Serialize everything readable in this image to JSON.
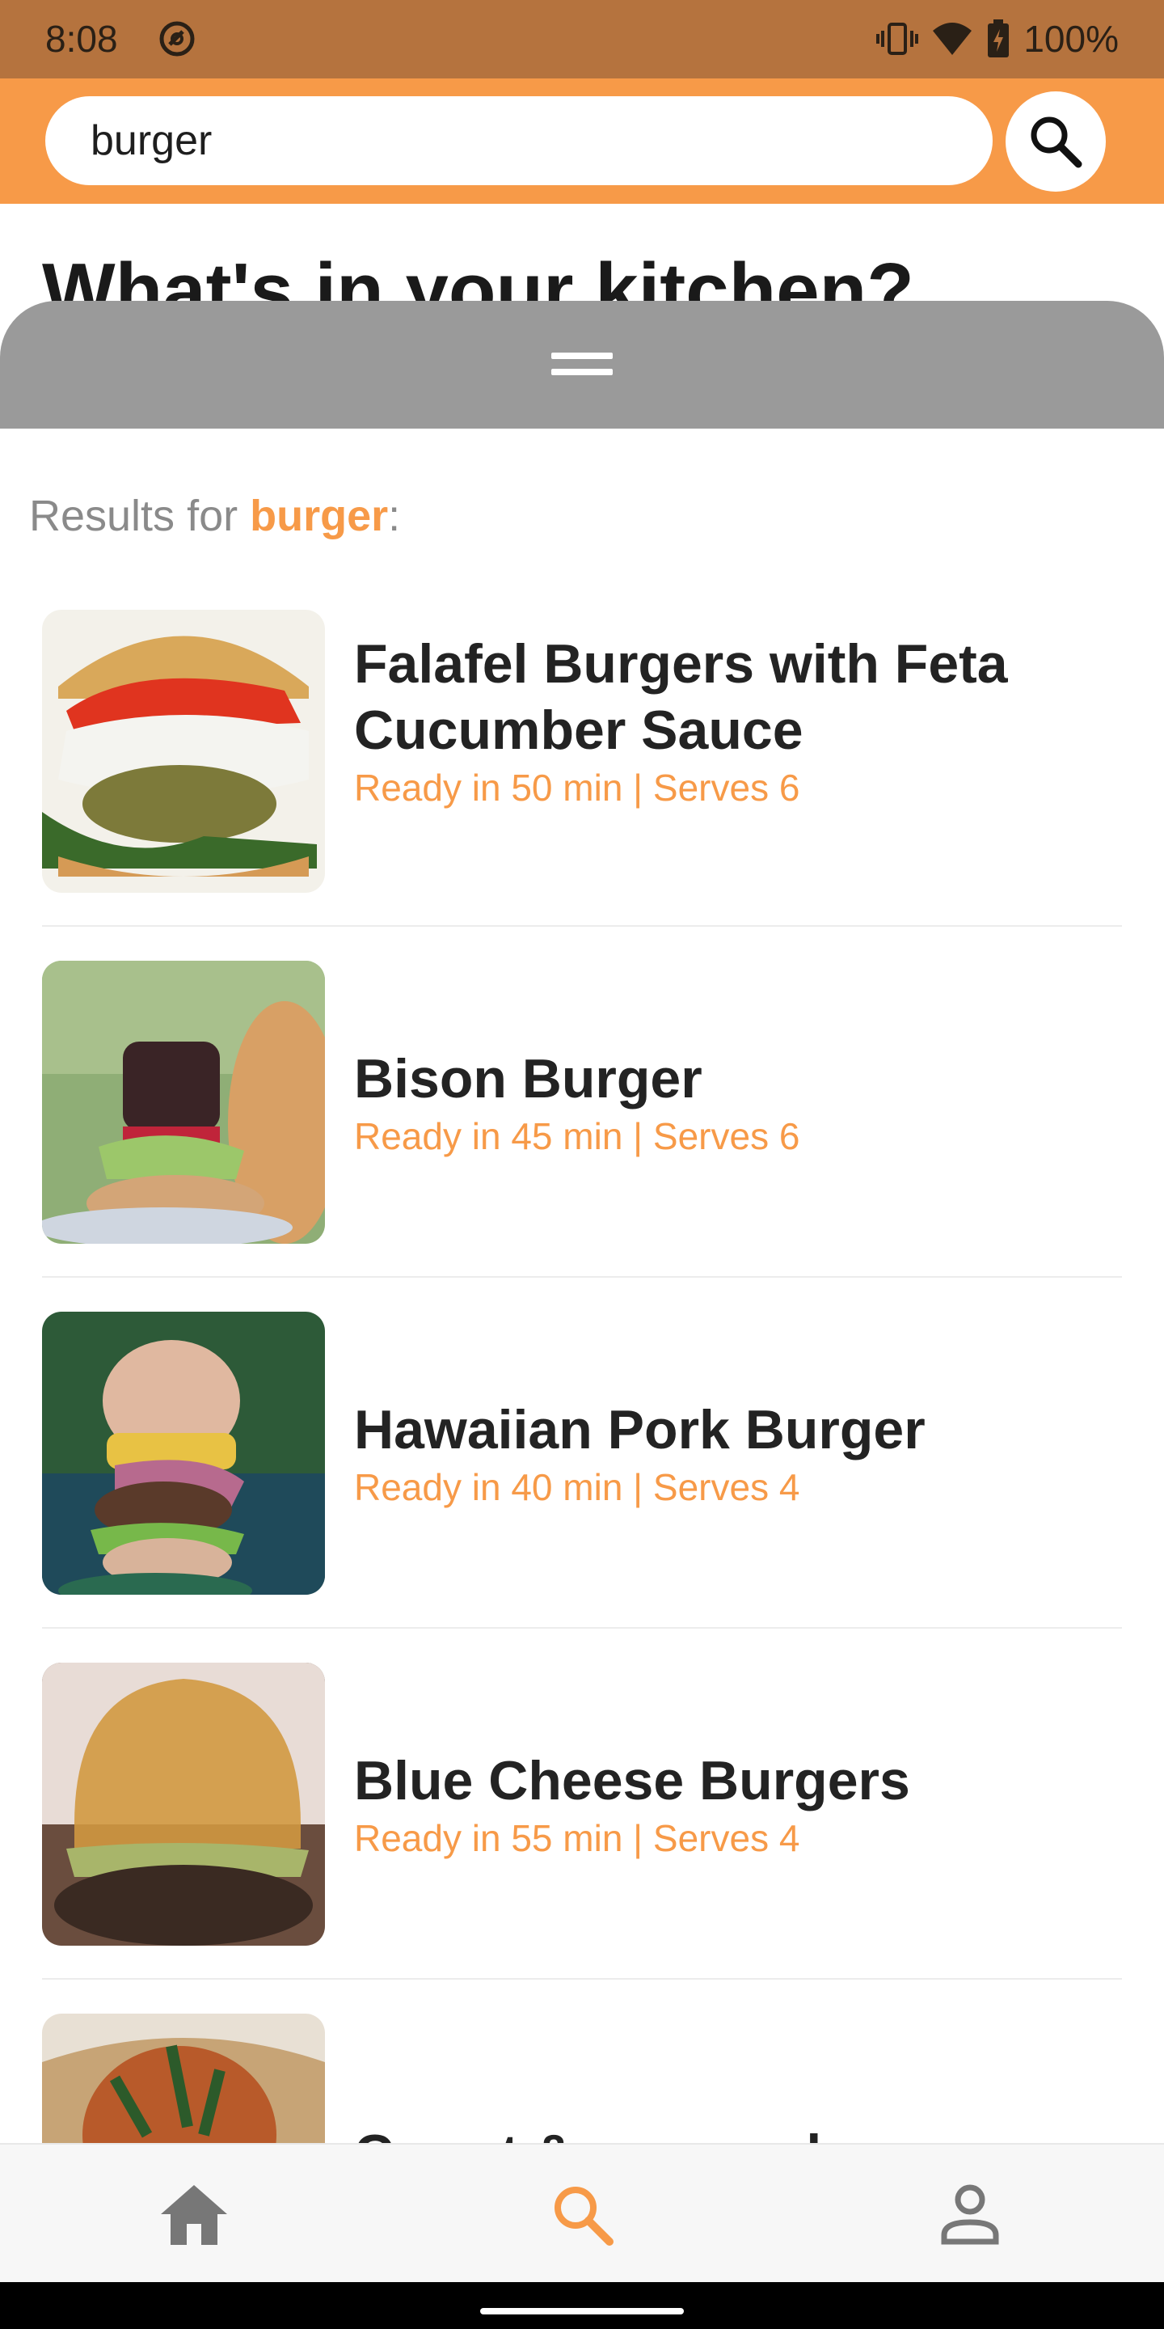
{
  "status_bar": {
    "time": "8:08",
    "battery": "100%",
    "icons": [
      "do-not-disturb-icon",
      "vibrate-icon",
      "wifi-icon",
      "battery-charging-icon"
    ]
  },
  "search": {
    "value": "burger",
    "button_icon": "search-icon"
  },
  "page": {
    "heading": "What's in your kitchen?"
  },
  "sheet": {
    "handle_icon": "drag-handle-icon",
    "results_prefix": "Results for ",
    "results_query": "burger",
    "results_suffix": ":"
  },
  "results": [
    {
      "title": "Falafel Burgers with Feta Cucumber Sauce",
      "meta": "Ready in 50 min | Serves 6"
    },
    {
      "title": "Bison Burger",
      "meta": "Ready in 45 min | Serves 6"
    },
    {
      "title": "Hawaiian Pork Burger",
      "meta": "Ready in 40 min | Serves 4"
    },
    {
      "title": "Blue Cheese Burgers",
      "meta": "Ready in 55 min | Serves 4"
    },
    {
      "title": "Carrot & sesame burgers",
      "meta": ""
    }
  ],
  "bottom_nav": {
    "items": [
      {
        "icon": "home-icon",
        "active": false
      },
      {
        "icon": "search-icon",
        "active": true
      },
      {
        "icon": "profile-icon",
        "active": false
      }
    ]
  },
  "colors": {
    "accent": "#f79a48",
    "status_bar": "#b5733e",
    "sheet_handle": "#9a9a9a",
    "nav_inactive": "#777777"
  }
}
